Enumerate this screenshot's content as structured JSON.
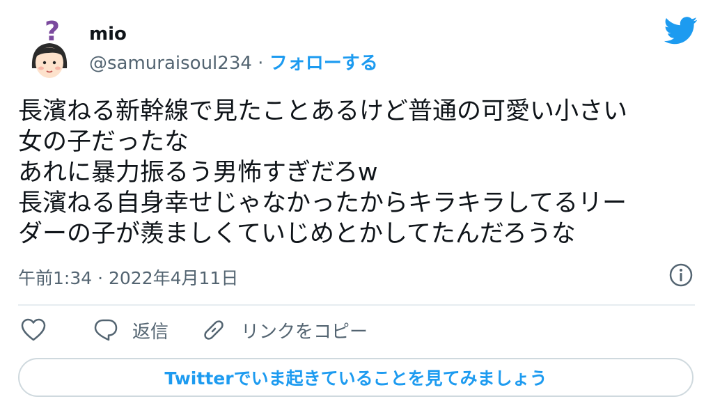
{
  "author": {
    "name": "mio",
    "handle": "@samuraisoul234",
    "separator": " · ",
    "follow_label": "フォローする"
  },
  "tweet": {
    "lines": [
      "長濱ねる新幹線で見たことあるけど普通の可愛い小さい",
      "女の子だったな",
      "あれに暴力振るう男怖すぎだろw",
      "長濱ねる自身幸せじゃなかったからキラキラしてるリー",
      "ダーの子が羨ましくていじめとかしてたんだろうな"
    ],
    "timestamp": "午前1:34 · 2022年4月11日"
  },
  "actions": {
    "like_icon": "heart-icon",
    "reply_label": "返信",
    "copy_link_label": "リンクをコピー"
  },
  "cta": {
    "label": "Twitterでいま起きていることを見てみましょう"
  },
  "colors": {
    "accent": "#1d9bf0",
    "secondary_text": "#536471",
    "divider": "#e6ecf0"
  }
}
